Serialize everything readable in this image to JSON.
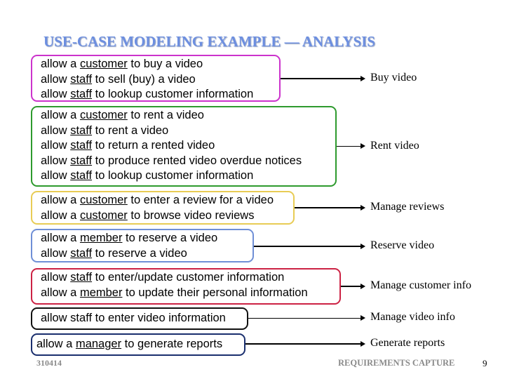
{
  "title": "USE-CASE MODELING EXAMPLE — ANALYSIS",
  "groups": [
    {
      "color": "#cc33cc",
      "use_case": "Buy video",
      "lines": [
        {
          "pre": "allow a ",
          "actor": "customer",
          "post": " to buy a video"
        },
        {
          "pre": "allow ",
          "actor": "staff",
          "post": " to sell (buy) a video"
        },
        {
          "pre": "allow ",
          "actor": "staff",
          "post": " to lookup customer information"
        }
      ]
    },
    {
      "color": "#2e9a2e",
      "use_case": "Rent video",
      "lines": [
        {
          "pre": "allow a ",
          "actor": "customer",
          "post": " to rent a video"
        },
        {
          "pre": "allow ",
          "actor": "staff",
          "post": " to rent a video"
        },
        {
          "pre": "allow ",
          "actor": "staff",
          "post": " to return a rented video"
        },
        {
          "pre": "allow ",
          "actor": "staff",
          "post": " to  produce rented video overdue notices"
        },
        {
          "pre": "allow ",
          "actor": "staff",
          "post": " to lookup customer information"
        }
      ]
    },
    {
      "color": "#e8cc55",
      "use_case": "Manage reviews",
      "lines": [
        {
          "pre": "allow a ",
          "actor": "customer",
          "post": " to enter a review for a video"
        },
        {
          "pre": "allow a ",
          "actor": "customer",
          "post": " to browse video reviews"
        }
      ]
    },
    {
      "color": "#6f8fd6",
      "use_case": "Reserve video",
      "lines": [
        {
          "pre": "allow a ",
          "actor": "member",
          "post": " to reserve a video"
        },
        {
          "pre": "allow ",
          "actor": "staff",
          "post": " to reserve a video"
        }
      ]
    },
    {
      "color": "#cc2244",
      "use_case": "Manage customer info",
      "lines": [
        {
          "pre": "allow ",
          "actor": "staff",
          "post": " to enter/update customer information"
        },
        {
          "pre": "allow a ",
          "actor": "member",
          "post": " to update their personal information"
        }
      ]
    },
    {
      "color": "#111111",
      "use_case": "Manage video info",
      "lines": [
        {
          "pre": "allow staff to enter video information",
          "actor": "",
          "post": ""
        }
      ]
    },
    {
      "color": "#1a2f6e",
      "use_case": "Generate reports",
      "lines": [
        {
          "pre": "allow a ",
          "actor": "manager",
          "post": " to generate reports"
        }
      ]
    }
  ],
  "footer": {
    "course_code": "310414",
    "section": "REQUIREMENTS CAPTURE",
    "page": "9"
  }
}
